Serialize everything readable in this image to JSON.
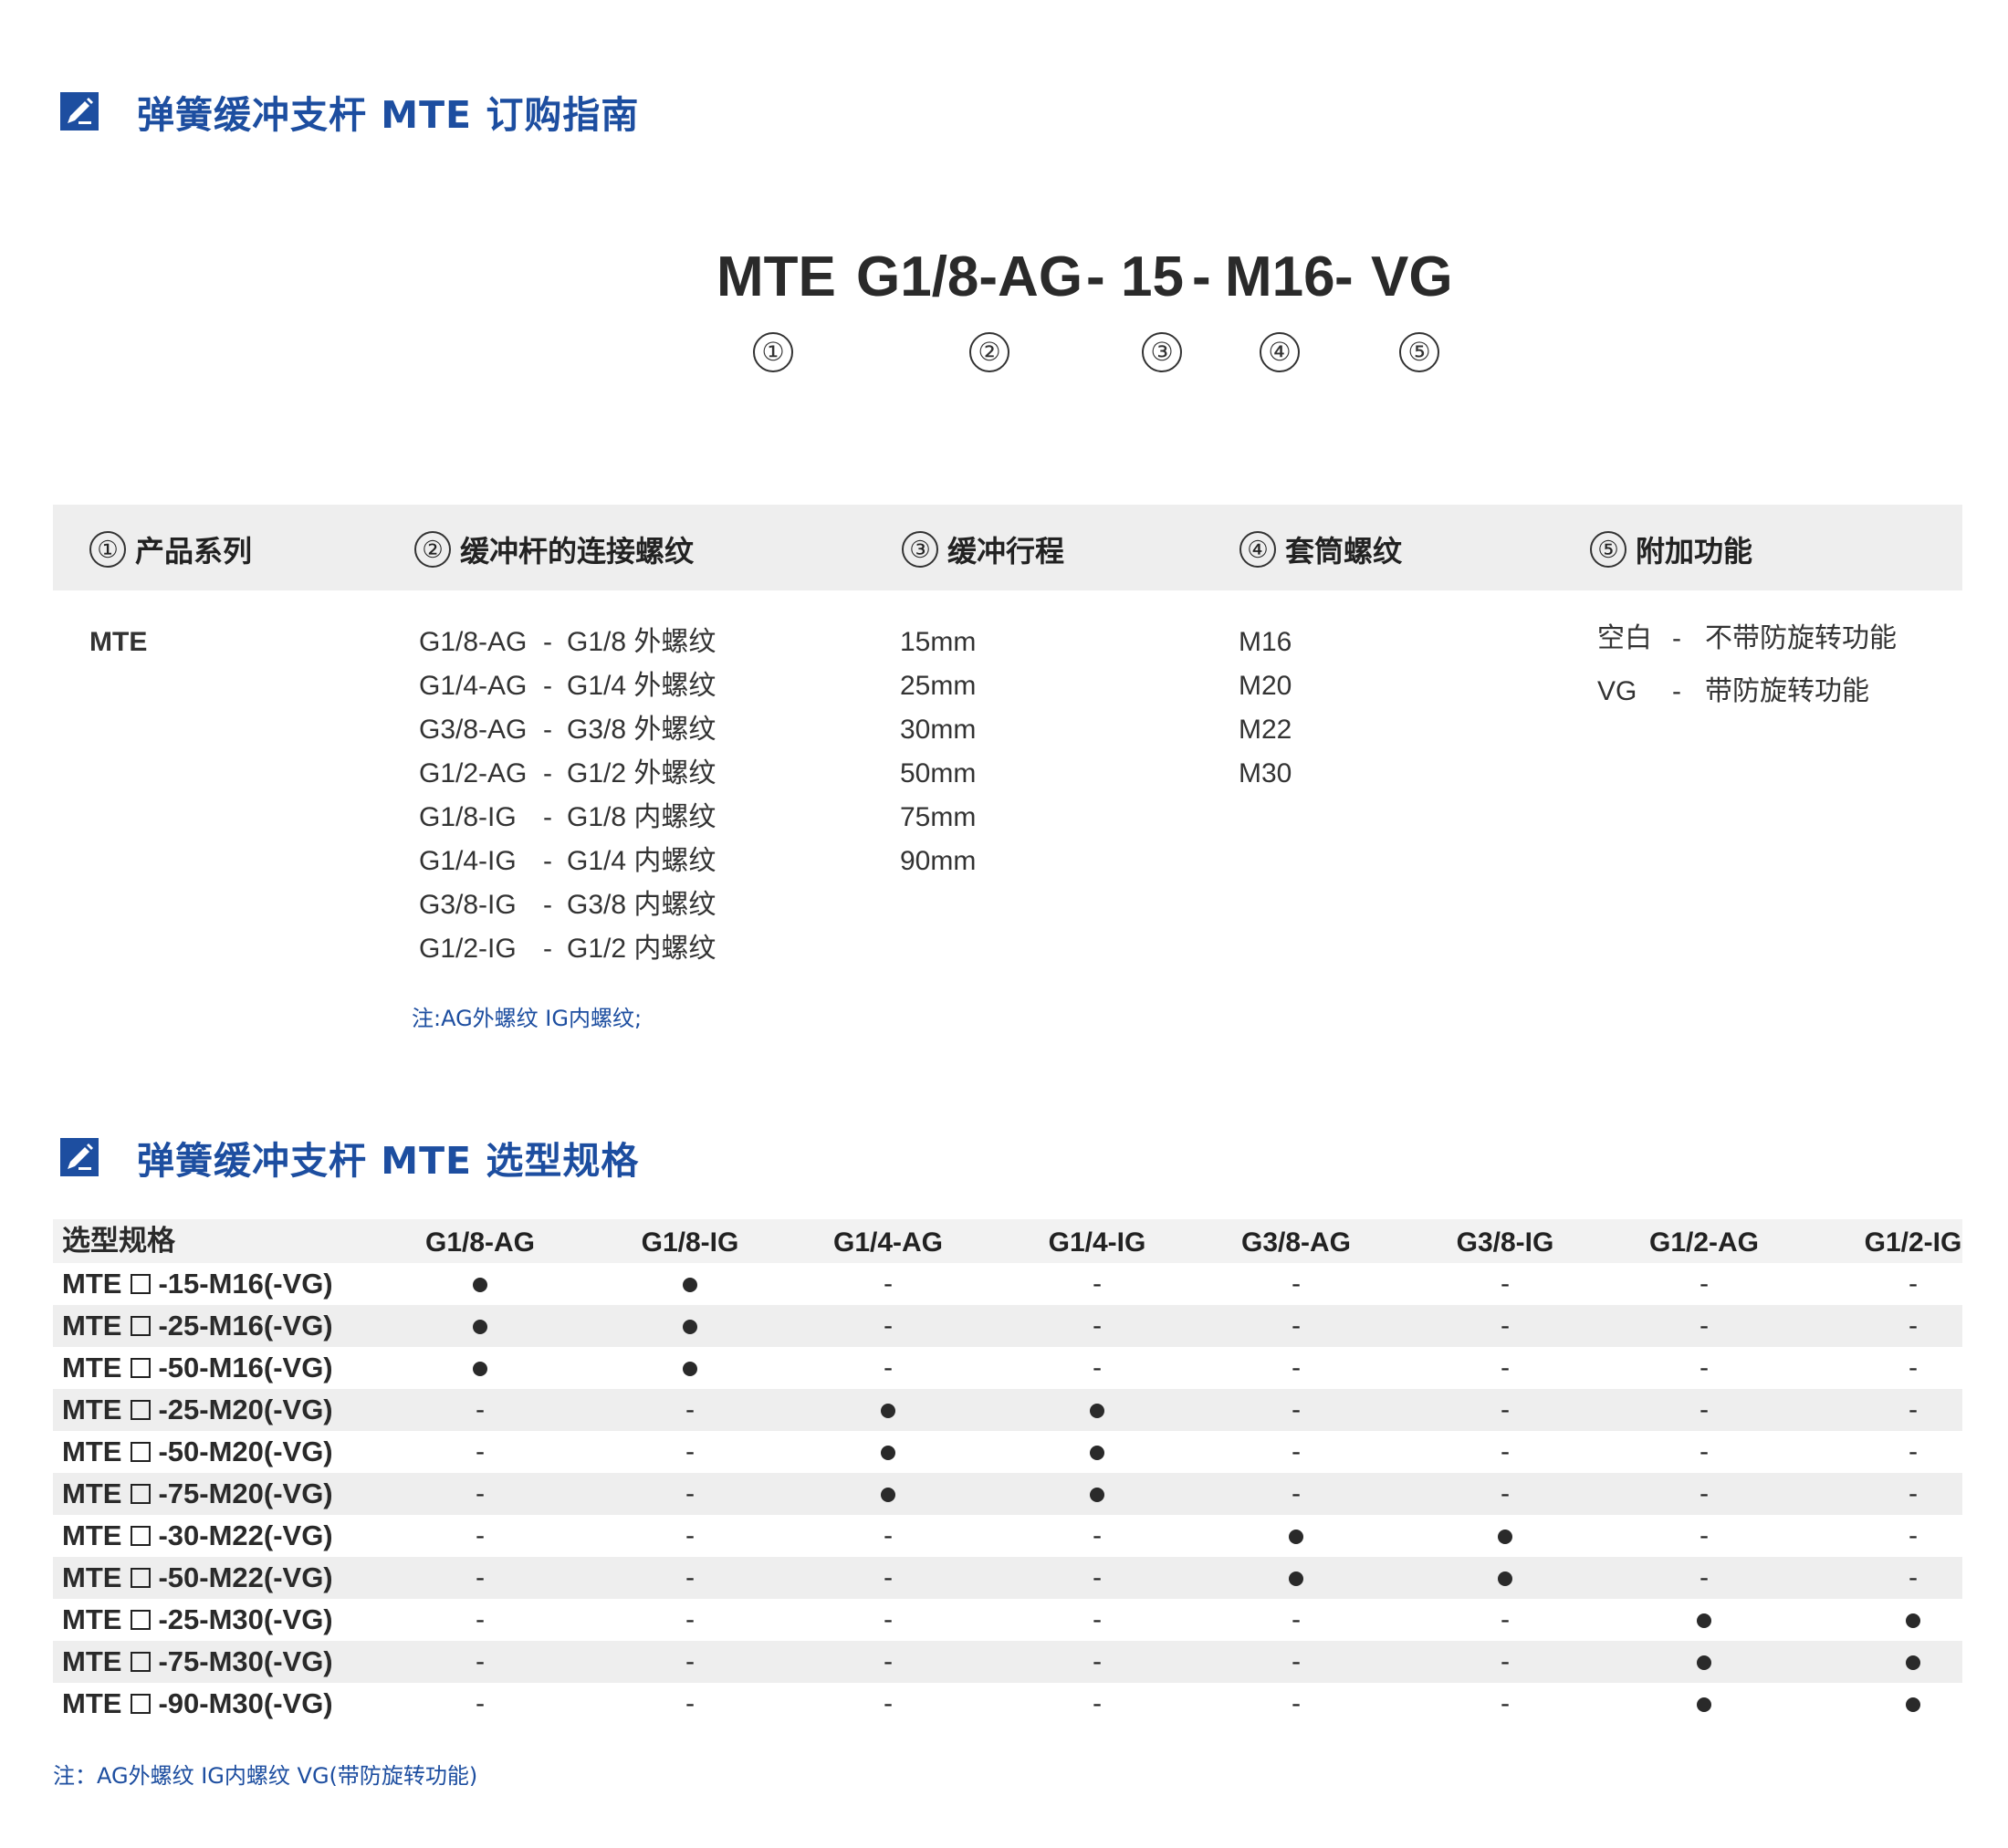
{
  "ordering_guide": {
    "title": "弹簧缓冲支杆 MTE 订购指南",
    "code_segments": [
      "MTE",
      "G1/8-AG",
      "-",
      "15",
      "-",
      "M16",
      "-",
      "VG"
    ],
    "code_numbers": [
      "①",
      "②",
      "③",
      "④",
      "⑤"
    ]
  },
  "options": {
    "headers": [
      {
        "num": "①",
        "label": "产品系列"
      },
      {
        "num": "②",
        "label": "缓冲杆的连接螺纹"
      },
      {
        "num": "③",
        "label": "缓冲行程"
      },
      {
        "num": "④",
        "label": "套筒螺纹"
      },
      {
        "num": "⑤",
        "label": "附加功能"
      }
    ],
    "series": [
      "MTE"
    ],
    "threads": [
      {
        "code": "G1/8-AG",
        "desc": "G1/8 外螺纹"
      },
      {
        "code": "G1/4-AG",
        "desc": "G1/4 外螺纹"
      },
      {
        "code": "G3/8-AG",
        "desc": "G3/8 外螺纹"
      },
      {
        "code": "G1/2-AG",
        "desc": "G1/2 外螺纹"
      },
      {
        "code": "G1/8-IG",
        "desc": "G1/8 内螺纹"
      },
      {
        "code": "G1/4-IG",
        "desc": "G1/4 内螺纹"
      },
      {
        "code": "G3/8-IG",
        "desc": "G3/8 内螺纹"
      },
      {
        "code": "G1/2-IG",
        "desc": "G1/2 内螺纹"
      }
    ],
    "thread_dash": "-",
    "strokes": [
      "15mm",
      "25mm",
      "30mm",
      "50mm",
      "75mm",
      "90mm"
    ],
    "sleeves": [
      "M16",
      "M20",
      "M22",
      "M30"
    ],
    "functions": [
      {
        "code": "空白",
        "desc": "不带防旋转功能"
      },
      {
        "code": "VG",
        "desc": "带防旋转功能"
      }
    ],
    "note": "注:AG外螺纹 IG内螺纹;"
  },
  "selection": {
    "title": "弹簧缓冲支杆 MTE 选型规格",
    "corner": "选型规格",
    "columns": [
      "G1/8-AG",
      "G1/8-IG",
      "G1/4-AG",
      "G1/4-IG",
      "G3/8-AG",
      "G3/8-IG",
      "G1/2-AG",
      "G1/2-IG"
    ],
    "row_prefix": "MTE",
    "rows": [
      {
        "suffix": "-15-M16(-VG)",
        "marks": [
          "●",
          "●",
          "-",
          "-",
          "-",
          "-",
          "-",
          "-"
        ]
      },
      {
        "suffix": "-25-M16(-VG)",
        "marks": [
          "●",
          "●",
          "-",
          "-",
          "-",
          "-",
          "-",
          "-"
        ]
      },
      {
        "suffix": "-50-M16(-VG)",
        "marks": [
          "●",
          "●",
          "-",
          "-",
          "-",
          "-",
          "-",
          "-"
        ]
      },
      {
        "suffix": "-25-M20(-VG)",
        "marks": [
          "-",
          "-",
          "●",
          "●",
          "-",
          "-",
          "-",
          "-"
        ]
      },
      {
        "suffix": "-50-M20(-VG)",
        "marks": [
          "-",
          "-",
          "●",
          "●",
          "-",
          "-",
          "-",
          "-"
        ]
      },
      {
        "suffix": "-75-M20(-VG)",
        "marks": [
          "-",
          "-",
          "●",
          "●",
          "-",
          "-",
          "-",
          "-"
        ]
      },
      {
        "suffix": "-30-M22(-VG)",
        "marks": [
          "-",
          "-",
          "-",
          "-",
          "●",
          "●",
          "-",
          "-"
        ]
      },
      {
        "suffix": "-50-M22(-VG)",
        "marks": [
          "-",
          "-",
          "-",
          "-",
          "●",
          "●",
          "-",
          "-"
        ]
      },
      {
        "suffix": "-25-M30(-VG)",
        "marks": [
          "-",
          "-",
          "-",
          "-",
          "-",
          "-",
          "●",
          "●"
        ]
      },
      {
        "suffix": "-75-M30(-VG)",
        "marks": [
          "-",
          "-",
          "-",
          "-",
          "-",
          "-",
          "●",
          "●"
        ]
      },
      {
        "suffix": "-90-M30(-VG)",
        "marks": [
          "-",
          "-",
          "-",
          "-",
          "-",
          "-",
          "●",
          "●"
        ]
      }
    ],
    "note": "注：AG外螺纹  IG内螺纹    VG(带防旋转功能)"
  },
  "colors": {
    "accent": "#1d4ea0",
    "text": "#222222",
    "shade": "#eeeeee"
  }
}
